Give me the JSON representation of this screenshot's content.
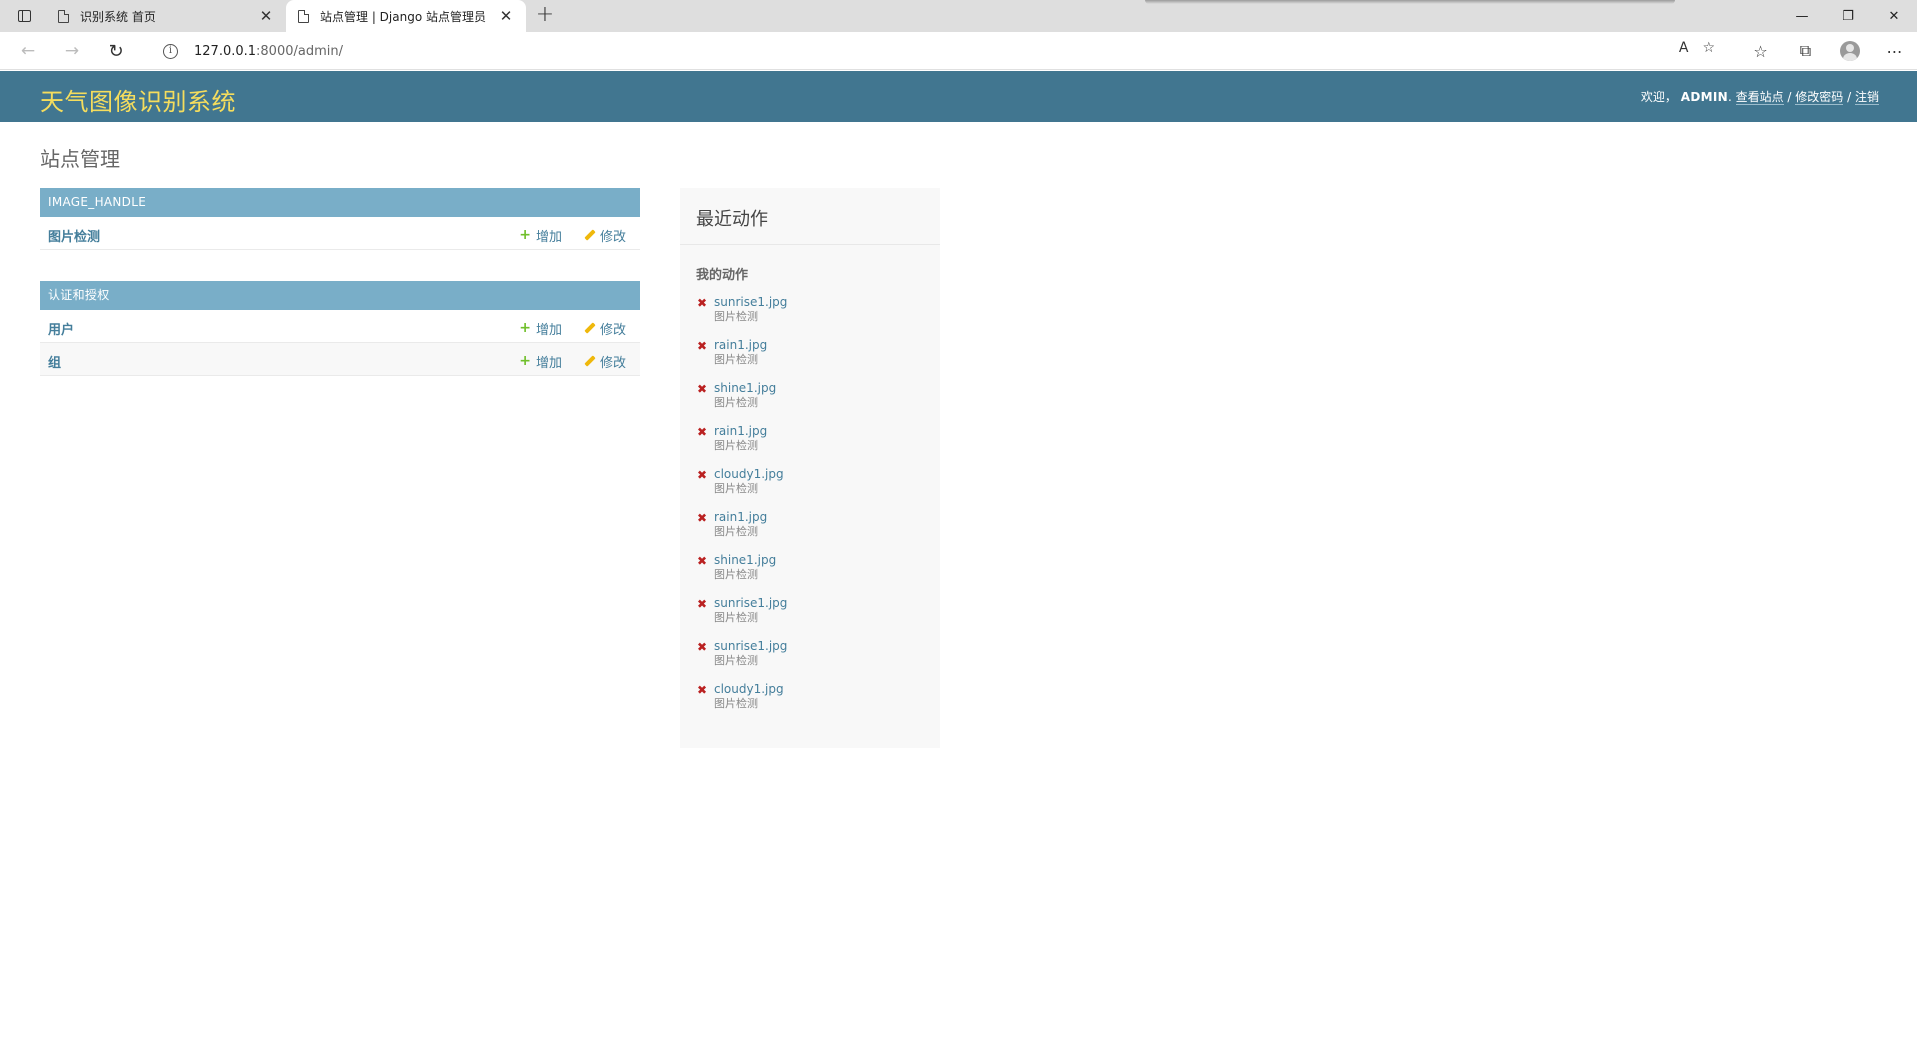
{
  "browser": {
    "tabs": [
      {
        "title": "识别系统 首页",
        "active": false
      },
      {
        "title": "站点管理 | Django 站点管理员",
        "active": true
      }
    ],
    "url_host": "127.0.0.1",
    "url_rest": ":8000/admin/",
    "icons": {
      "sidebar": "sidebar-icon",
      "back": "←",
      "forward": "→",
      "reload": "↻",
      "new_tab": "+",
      "close_tab": "✕",
      "info": "i",
      "read_aloud": "A",
      "favorite_add": "☆",
      "favorites": "☆",
      "collections": "⧉",
      "more": "⋯",
      "minimize": "—",
      "restore": "❐",
      "close_window": "✕"
    }
  },
  "header": {
    "branding": "天气图像识别系统",
    "welcome": "欢迎，",
    "username": "ADMIN",
    "view_site": "查看站点",
    "change_password": "修改密码",
    "logout": "注销",
    "separator": " / "
  },
  "page": {
    "title": "站点管理"
  },
  "apps": [
    {
      "caption": "IMAGE_HANDLE",
      "models": [
        {
          "name": "图片检测",
          "add": "增加",
          "change": "修改"
        }
      ]
    },
    {
      "caption": "认证和授权",
      "models": [
        {
          "name": "用户",
          "add": "增加",
          "change": "修改"
        },
        {
          "name": "组",
          "add": "增加",
          "change": "修改"
        }
      ]
    }
  ],
  "recent_actions": {
    "title": "最近动作",
    "subtitle": "我的动作",
    "items": [
      {
        "object": "sunrise1.jpg",
        "type": "图片检测"
      },
      {
        "object": "rain1.jpg",
        "type": "图片检测"
      },
      {
        "object": "shine1.jpg",
        "type": "图片检测"
      },
      {
        "object": "rain1.jpg",
        "type": "图片检测"
      },
      {
        "object": "cloudy1.jpg",
        "type": "图片检测"
      },
      {
        "object": "rain1.jpg",
        "type": "图片检测"
      },
      {
        "object": "shine1.jpg",
        "type": "图片检测"
      },
      {
        "object": "sunrise1.jpg",
        "type": "图片检测"
      },
      {
        "object": "sunrise1.jpg",
        "type": "图片检测"
      },
      {
        "object": "cloudy1.jpg",
        "type": "图片检测"
      }
    ]
  },
  "colors": {
    "header_bg": "#417690",
    "branding": "#f5dd5d",
    "module_caption_bg": "#79aec8",
    "link": "#447e9b",
    "add_icon": "#70bf2b",
    "change_icon": "#efb80b",
    "deletion_icon": "#ba2121"
  }
}
